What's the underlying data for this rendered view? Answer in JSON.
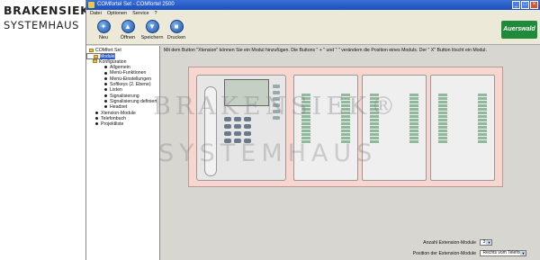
{
  "logo": {
    "line1": "BRAKENSIEK",
    "reg": "®",
    "line2": "SYSTEMHAUS"
  },
  "window": {
    "title": "COMfortel Set  -  COMfortel 2500",
    "minimize": "_",
    "maximize": "□",
    "close": "×"
  },
  "menu": [
    "Datei",
    "Optionen",
    "Service",
    "?"
  ],
  "toolbar": {
    "buttons": [
      "Neu",
      "Öffnen",
      "Speichern",
      "Drucken"
    ],
    "brand": "Auerswald"
  },
  "tree": {
    "root": "COMfort Set",
    "items": [
      {
        "label": "Module",
        "level": 1,
        "selected": true,
        "folder": true
      },
      {
        "label": "Konfiguration",
        "level": 1,
        "folder": true
      },
      {
        "label": "Allgemein",
        "level": 2
      },
      {
        "label": "Menü-Funktionen",
        "level": 2
      },
      {
        "label": "Menü-Einstellungen",
        "level": 2
      },
      {
        "label": "Softkeys (2. Ebene)",
        "level": 2
      },
      {
        "label": "Listen",
        "level": 2
      },
      {
        "label": "Signalisierung",
        "level": 2
      },
      {
        "label": "Signalisierung definiert",
        "level": 2
      },
      {
        "label": "Headset",
        "level": 2
      },
      {
        "label": "Xtension-Module",
        "level": 1
      },
      {
        "label": "Telefonbuch",
        "level": 1
      },
      {
        "label": "Projektliste",
        "level": 1
      }
    ]
  },
  "info_text": "Mit dem Button \"Xtension\" können Sie ein Modul hinzufügen. Die Buttons \" + \" und \" \" verändern die Position eines Moduls. Der \" X\" Button löscht ein Modul.",
  "watermark": {
    "line1": "BRAKENSIEK®",
    "line2": "SYSTEMHAUS"
  },
  "form": {
    "modules_label": "Anzahl Extension-Module",
    "modules_value": "3",
    "position_label": "Position der Extension-Module",
    "position_value": "Rechts vom Telefon"
  },
  "colors": {
    "canvas": "#f7d6cf",
    "accent": "#2b57c4",
    "brand": "#1f8a3a"
  }
}
